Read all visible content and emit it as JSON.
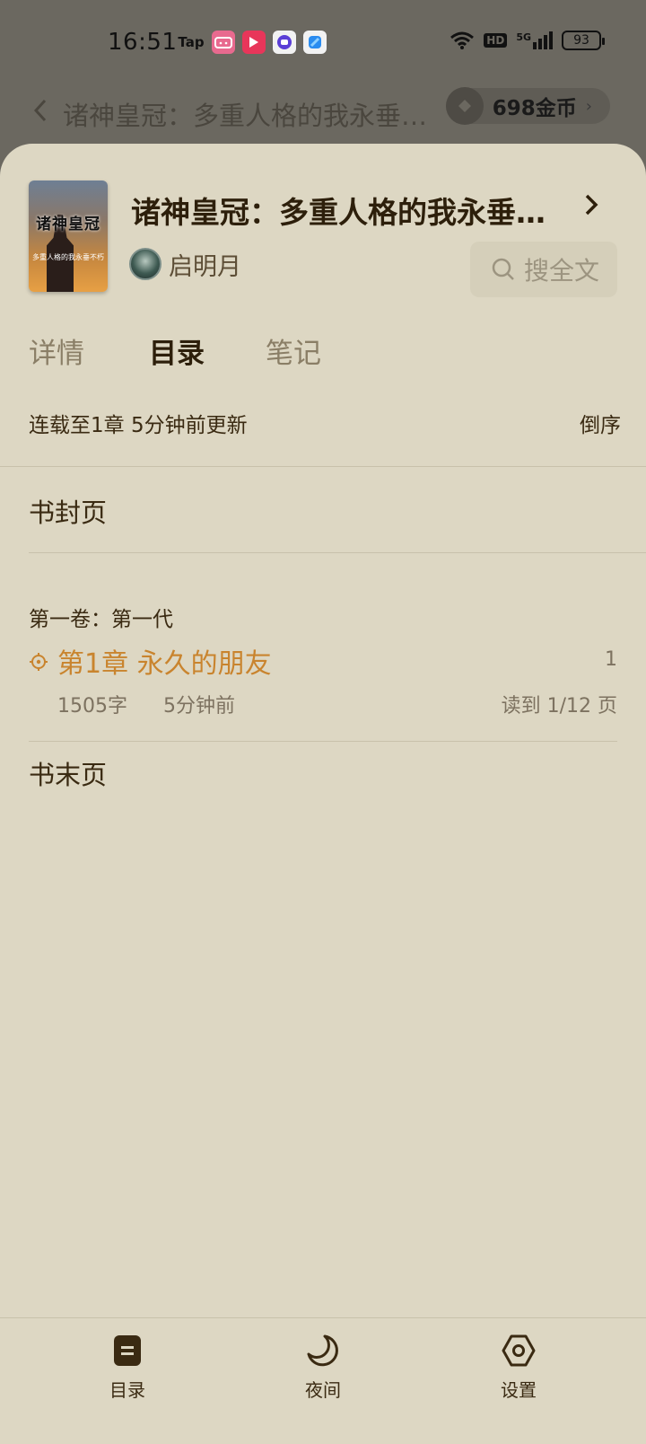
{
  "status_bar": {
    "time": "16:51",
    "app_icons": [
      "Tap",
      "bilibili",
      "video",
      "message",
      "blue-app"
    ],
    "tap_label": "Tap",
    "hd_label": "HD",
    "network_label": "5G",
    "battery": "93"
  },
  "reader_header": {
    "title": "诸神皇冠：多重人格的我永垂…",
    "coins": "698金币"
  },
  "book": {
    "title": "诸神皇冠：多重人格的我永垂…",
    "author": "启明月",
    "cover_title": "诸神皇冠",
    "cover_subtitle": "多重人格的我永垂不朽",
    "search_label": "搜全文"
  },
  "tabs": [
    {
      "label": "详情",
      "active": false
    },
    {
      "label": "目录",
      "active": true
    },
    {
      "label": "笔记",
      "active": false
    }
  ],
  "catalog": {
    "summary": "连载至1章 5分钟前更新",
    "sort_label": "倒序",
    "cover_page": "书封页",
    "volume": "第一卷：第一代",
    "chapter": {
      "title": "第1章 永久的朋友",
      "index": "1",
      "words": "1505字",
      "updated": "5分钟前",
      "progress": "读到 1/12 页"
    },
    "end_page": "书末页"
  },
  "bottom_nav": {
    "items": [
      {
        "label": "目录",
        "icon": "catalog-icon"
      },
      {
        "label": "夜间",
        "icon": "moon-icon"
      },
      {
        "label": "设置",
        "icon": "settings-icon"
      }
    ]
  },
  "colors": {
    "sheet_bg": "#ddd7c3",
    "accent": "#c9842e",
    "text_dark": "#2d1f0b",
    "overlay": "#6b6860"
  }
}
